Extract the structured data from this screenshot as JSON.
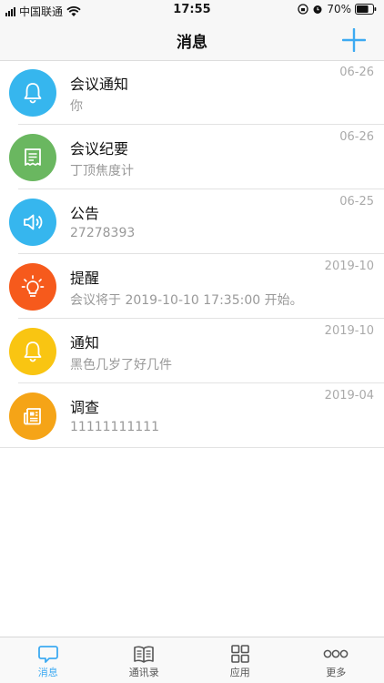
{
  "status_bar": {
    "carrier": "中国联通",
    "time": "17:55",
    "battery": "70%"
  },
  "header": {
    "title": "消息",
    "add_icon": "plus-icon"
  },
  "messages": [
    {
      "title": "会议通知",
      "subtitle": "你",
      "date": "06-26",
      "icon": "bell-icon",
      "color": "#36b6ee"
    },
    {
      "title": "会议纪要",
      "subtitle": "丁顶焦度计",
      "date": "06-26",
      "icon": "receipt-icon",
      "color": "#6ab760"
    },
    {
      "title": "公告",
      "subtitle": "27278393",
      "date": "06-25",
      "icon": "speaker-icon",
      "color": "#36b6ee"
    },
    {
      "title": "提醒",
      "subtitle": "会议将于 2019-10-10 17:35:00 开始。",
      "date": "2019-10",
      "icon": "lightbulb-icon",
      "color": "#f65a1c"
    },
    {
      "title": "通知",
      "subtitle": "黑色几岁了好几件",
      "date": "2019-10",
      "icon": "bell-icon",
      "color": "#f9c512"
    },
    {
      "title": "调查",
      "subtitle": "11111111111",
      "date": "2019-04",
      "icon": "newspaper-icon",
      "color": "#f5a417"
    }
  ],
  "tabs": [
    {
      "label": "消息",
      "icon": "chat-bubble-icon",
      "active": true
    },
    {
      "label": "通讯录",
      "icon": "book-icon",
      "active": false
    },
    {
      "label": "应用",
      "icon": "grid-icon",
      "active": false
    },
    {
      "label": "更多",
      "icon": "more-dots-icon",
      "active": false
    }
  ]
}
